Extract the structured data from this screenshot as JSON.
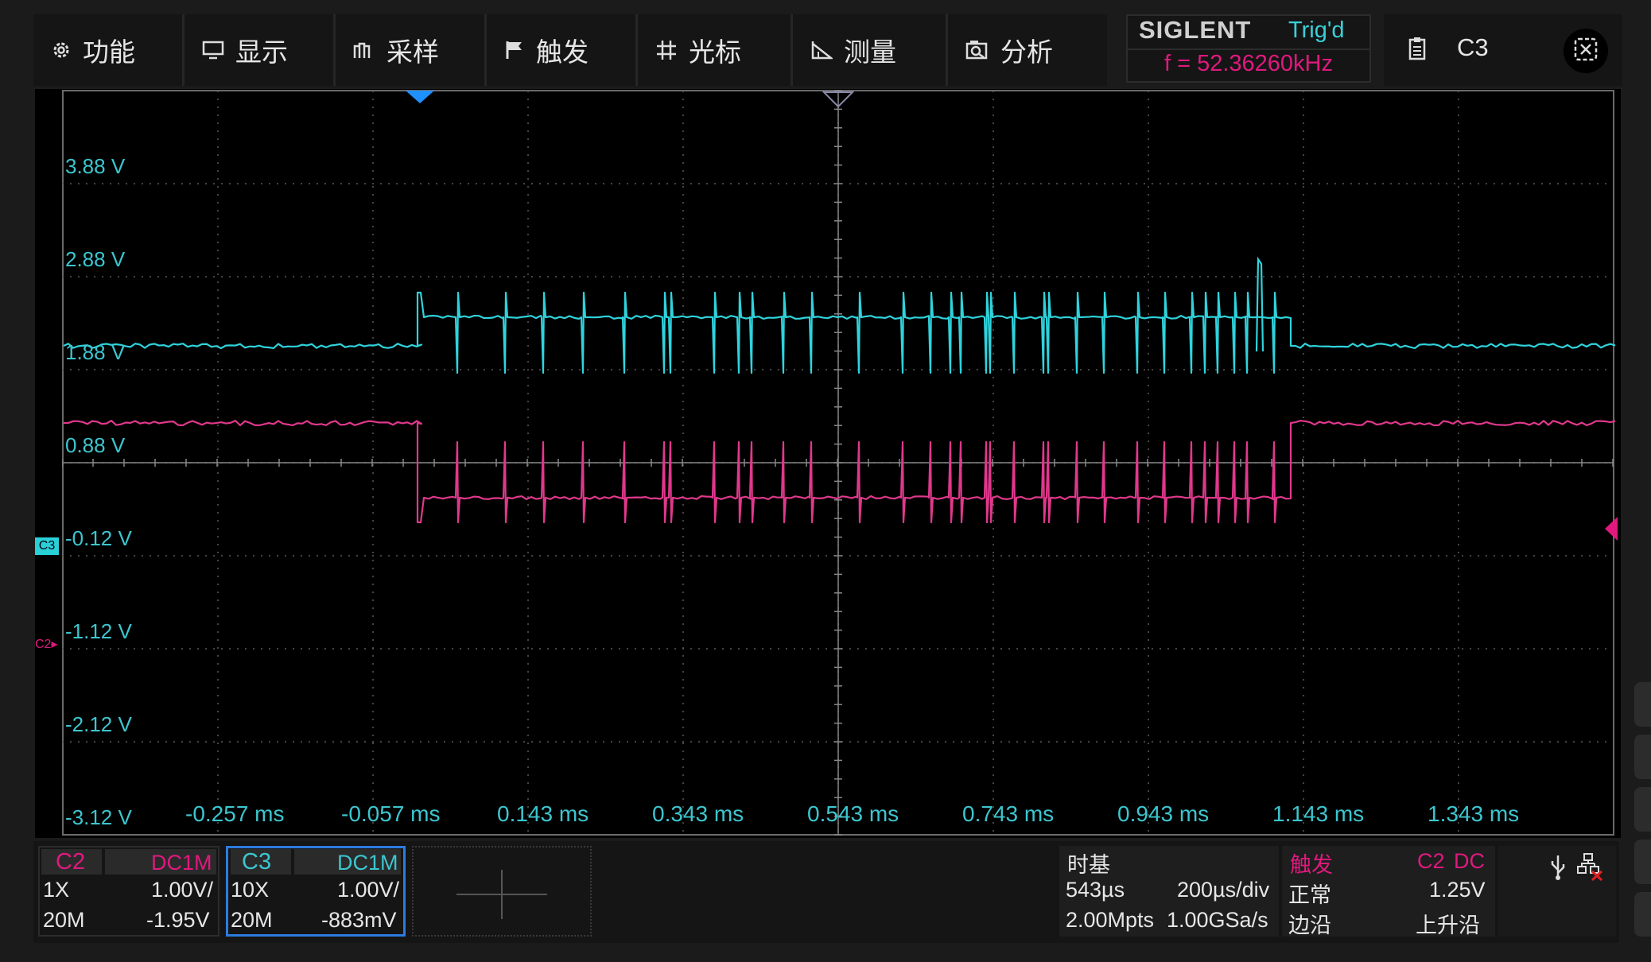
{
  "menu": {
    "items": [
      {
        "label": "功能",
        "icon": "gear-icon"
      },
      {
        "label": "显示",
        "icon": "monitor-icon"
      },
      {
        "label": "采样",
        "icon": "acquire-icon"
      },
      {
        "label": "触发",
        "icon": "flag-icon"
      },
      {
        "label": "光标",
        "icon": "cursor-icon"
      },
      {
        "label": "测量",
        "icon": "measure-icon"
      },
      {
        "label": "分析",
        "icon": "analysis-icon"
      }
    ]
  },
  "brand": "SIGLENT",
  "trigger_status": "Trig'd",
  "frequency": "f = 52.36260kHz",
  "active_channel": "C3",
  "screen": {
    "voltage_labels": [
      "3.88 V",
      "2.88 V",
      "1.88 V",
      "0.88 V",
      "-0.12 V",
      "-1.12 V",
      "-2.12 V",
      "-3.12 V"
    ],
    "time_labels": [
      "-0.257 ms",
      "-0.057 ms",
      "0.143 ms",
      "0.343 ms",
      "0.543 ms",
      "0.743 ms",
      "0.943 ms",
      "1.143 ms",
      "1.343 ms"
    ],
    "c3_marker": "C3",
    "c2_marker": "C2",
    "trace_colors": {
      "c3": "#2fd3dc",
      "c2": "#e0388c"
    }
  },
  "channels": {
    "c2": {
      "name": "C2",
      "coupling": "DC1M",
      "probe": "1X",
      "scale": "1.00V/",
      "bw": "20M",
      "offset": "-1.95V"
    },
    "c3": {
      "name": "C3",
      "coupling": "DC1M",
      "probe": "10X",
      "scale": "1.00V/",
      "bw": "20M",
      "offset": "-883mV"
    }
  },
  "timebase": {
    "label": "时基",
    "delay": "543µs",
    "scale": "200µs/div",
    "memory": "2.00Mpts",
    "sample_rate": "1.00GSa/s"
  },
  "trigger": {
    "label": "触发",
    "source": "C2",
    "coupling": "DC",
    "mode": "正常",
    "level": "1.25V",
    "type": "边沿",
    "slope": "上升沿"
  },
  "colors": {
    "cyan": "#3cc6cf",
    "magenta": "#e0197e",
    "grid": "#5a5a5a",
    "background": "#000000"
  }
}
